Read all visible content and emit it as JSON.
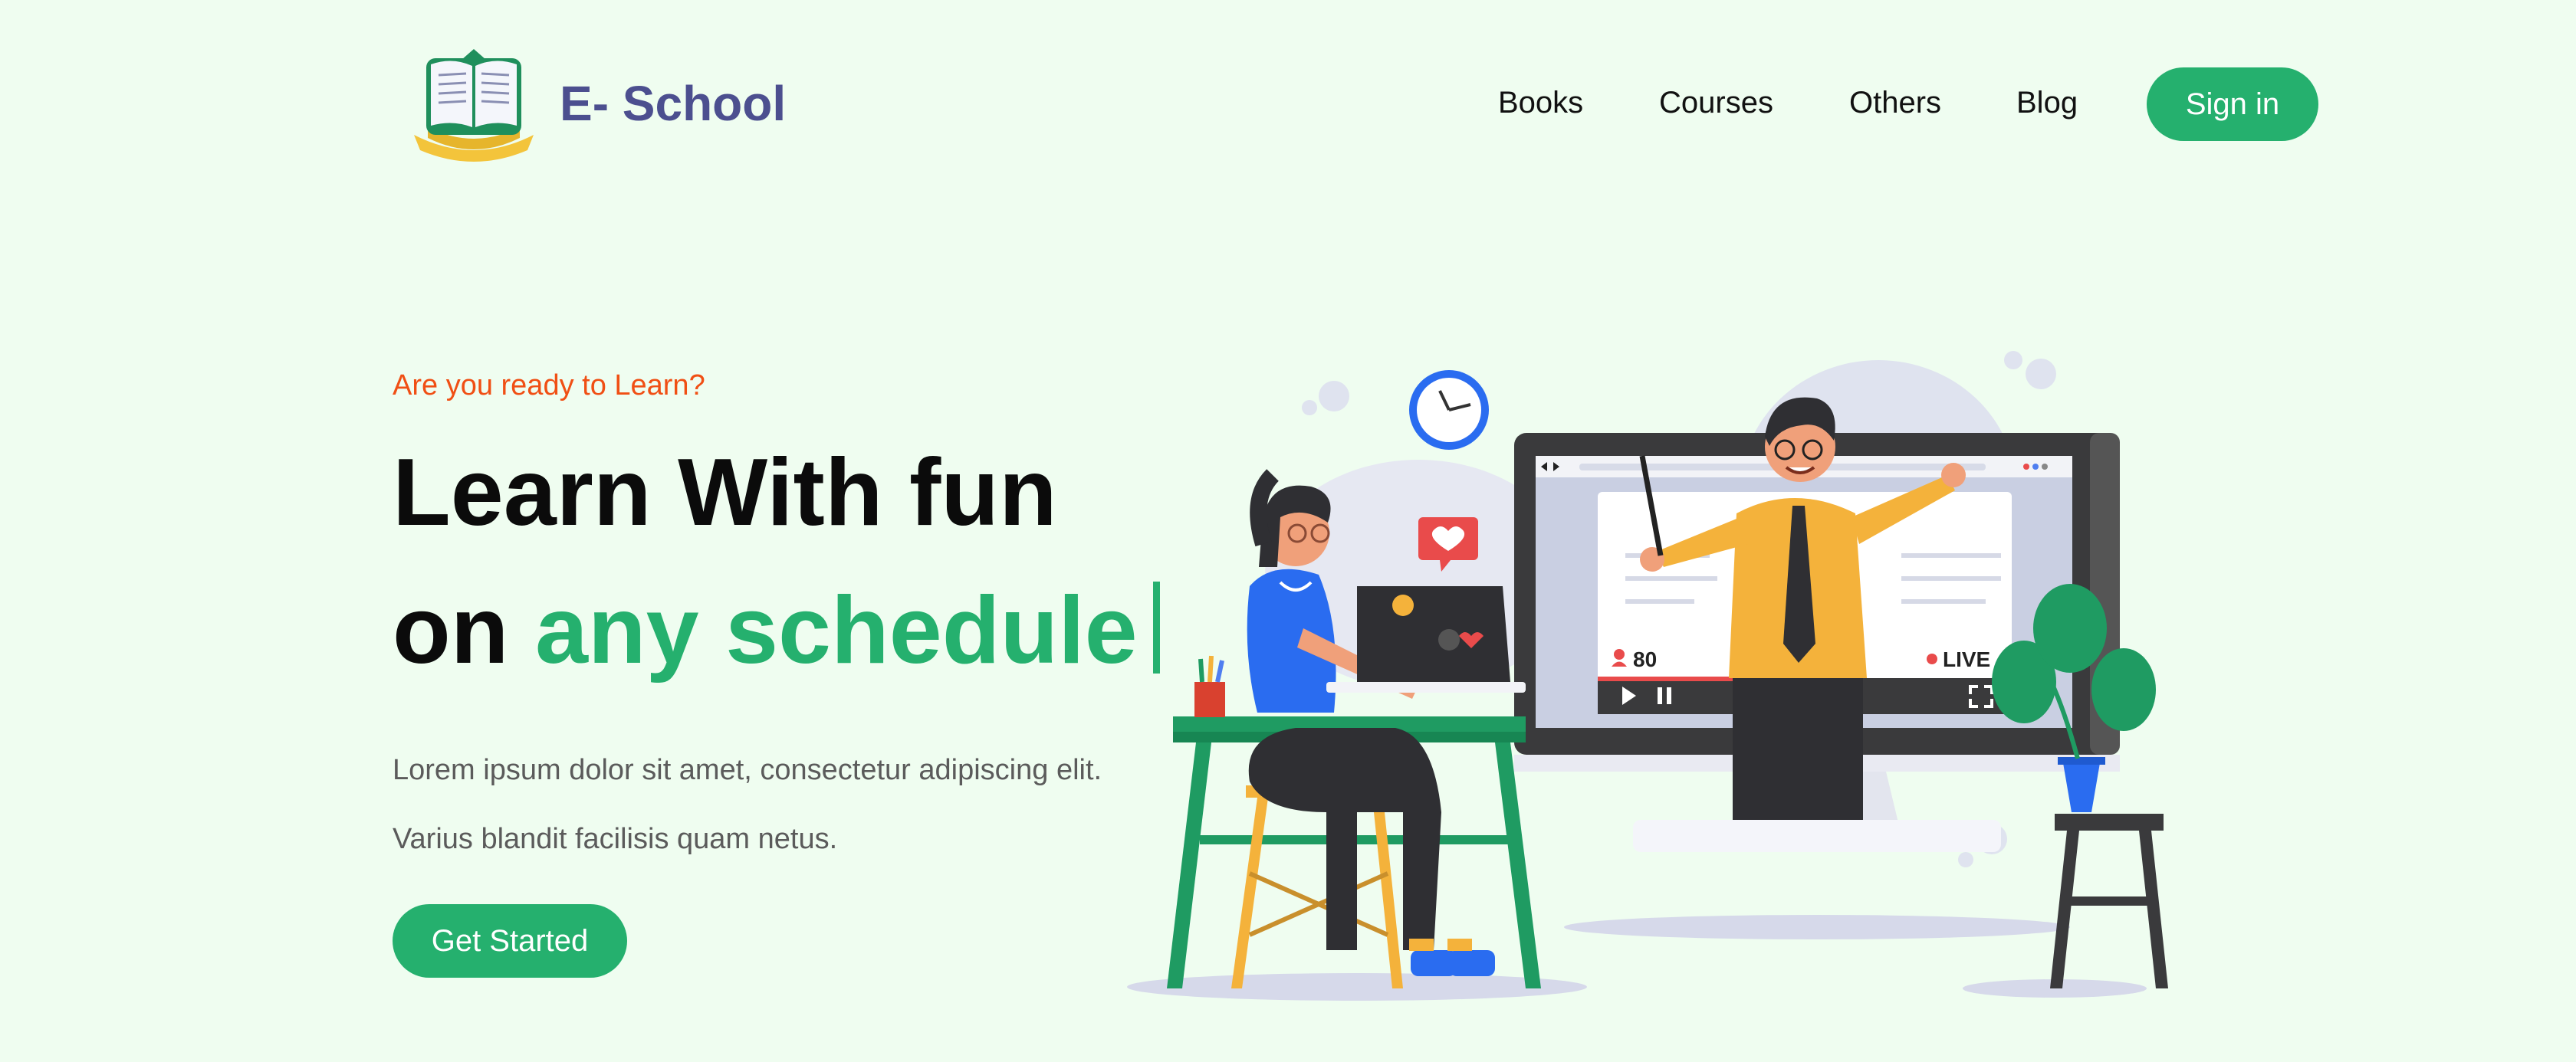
{
  "header": {
    "brand": "E- School",
    "nav": [
      {
        "label": "Books"
      },
      {
        "label": "Courses"
      },
      {
        "label": "Others"
      },
      {
        "label": "Blog"
      }
    ],
    "signin_label": "Sign in"
  },
  "hero": {
    "tagline": "Are you ready to Learn?",
    "headline_line1": "Learn With fun",
    "headline_line2_prefix": "on",
    "headline_line2_accent": "any schedule",
    "paragraph": "Lorem ipsum dolor sit amet, consectetur adipiscing elit. Varius blandit facilisis quam netus.",
    "cta_label": "Get Started"
  },
  "illustration": {
    "viewer_count": "80",
    "live_label": "LIVE",
    "icons": [
      "clock-icon",
      "heart-icon",
      "play-icon",
      "pause-icon",
      "fullscreen-icon",
      "viewer-icon"
    ]
  },
  "colors": {
    "background": "#effdf0",
    "accent": "#25b06e",
    "tagline": "#f04f14",
    "brand": "#4c4f8f"
  }
}
